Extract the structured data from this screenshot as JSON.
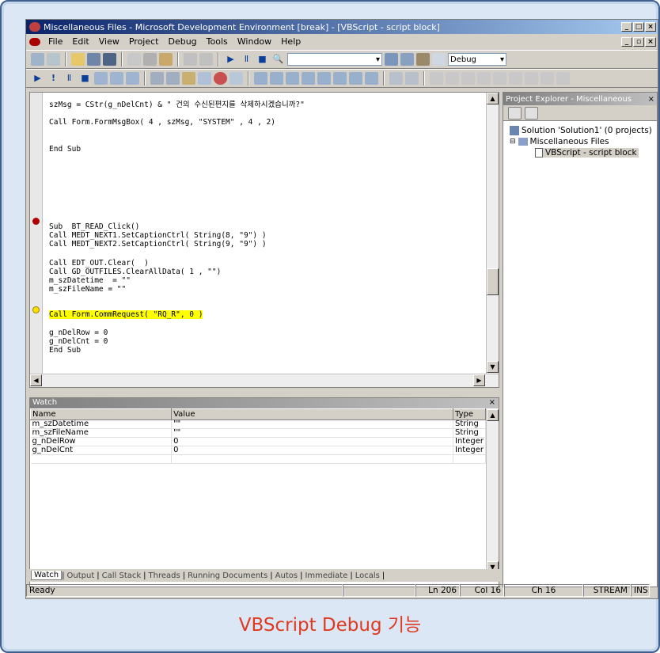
{
  "window": {
    "title": "Miscellaneous Files - Microsoft Development Environment [break] - [VBScript - script block]",
    "controls": [
      "_",
      "□",
      "×"
    ]
  },
  "menu": [
    "File",
    "Edit",
    "View",
    "Project",
    "Debug",
    "Tools",
    "Window",
    "Help"
  ],
  "toolbar": {
    "config": "Debug"
  },
  "code_lines": [
    "szMsg = CStr(g_nDelCnt) & \" 건의 수신된편지를 삭제하시겠습니까?\"",
    "",
    "Call Form.FormMsgBox( 4 , szMsg, \"SYSTEM\" , 4 , 2)",
    "",
    "",
    "",
    "End Sub",
    "",
    "",
    "",
    "",
    "",
    "",
    "",
    "Sub  BT_READ_Click()",
    "Call MEDT_NEXT1.SetCaptionCtrl( String(8, \"9\") )",
    "Call MEDT_NEXT2.SetCaptionCtrl( String(9, \"9\") )",
    "",
    "Call EDT_OUT.Clear(  )",
    "Call GD_OUTFILES.ClearAllData( 1 , \"\")",
    "m_szDatetime  = \"\"",
    "m_szFileName = \"\"",
    "",
    "",
    "",
    "Call Form.CommRequest( \"RQ_R\", 0 )",
    "",
    "g_nDelRow = 0",
    "g_nDelCnt = 0",
    "End Sub"
  ],
  "project_explorer": {
    "title": "Project Explorer - Miscellaneous",
    "solution": "Solution 'Solution1' (0 projects)",
    "folder": "Miscellaneous Files",
    "file": "VBScript - script block"
  },
  "watch": {
    "title": "Watch",
    "close": "×",
    "columns": [
      "Name",
      "Value",
      "Type"
    ],
    "rows": [
      [
        "m_szDatetime",
        "\"\"",
        "String"
      ],
      [
        "m_szFileName",
        "\"\"",
        "String"
      ],
      [
        "g_nDelRow",
        "0",
        "Integer"
      ],
      [
        "g_nDelCnt",
        "0",
        "Integer"
      ]
    ]
  },
  "tabs": [
    "Watch",
    "Output",
    "Call Stack",
    "Threads",
    "Running Documents",
    "Autos",
    "Immediate",
    "Locals"
  ],
  "status": {
    "text": "Ready",
    "ln": "Ln 206",
    "col": "Col 16",
    "ch": "Ch 16",
    "mode1": "STREAM",
    "mode2": "INS"
  },
  "caption": "VBScript Debug 기능"
}
